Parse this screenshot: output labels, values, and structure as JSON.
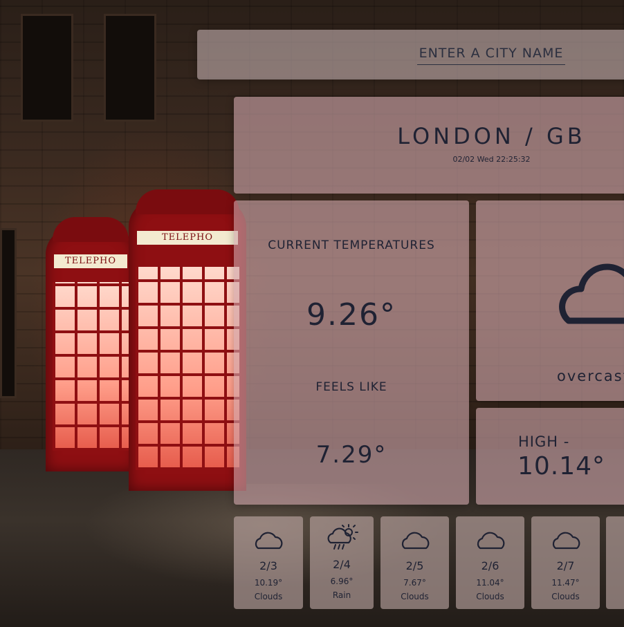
{
  "search": {
    "placeholder": "ENTER A CITY NAME"
  },
  "location": {
    "title": "LONDON / GB",
    "datetime": "02/02 Wed 22:25:32"
  },
  "current": {
    "temp_label": "CURRENT TEMPERATURES",
    "temp_value": "9.26°",
    "feels_label": "FEELS LIKE",
    "feels_value": "7.29°"
  },
  "condition": {
    "icon": "cloud-icon",
    "description": "overcast c"
  },
  "high": {
    "label": "HIGH -",
    "value": "10.14°"
  },
  "forecast": [
    {
      "date": "2/3",
      "temp": "10.19°",
      "condition": "Clouds",
      "icon": "cloud-icon"
    },
    {
      "date": "2/4",
      "temp": "6.96°",
      "condition": "Rain",
      "icon": "rain-sun-icon"
    },
    {
      "date": "2/5",
      "temp": "7.67°",
      "condition": "Clouds",
      "icon": "cloud-icon"
    },
    {
      "date": "2/6",
      "temp": "11.04°",
      "condition": "Clouds",
      "icon": "cloud-icon"
    },
    {
      "date": "2/7",
      "temp": "11.47°",
      "condition": "Clouds",
      "icon": "cloud-icon"
    }
  ],
  "background_scene": {
    "booth_signs": [
      "TELEPHO",
      "TELEPHO"
    ]
  },
  "colors": {
    "text": "#1f2233",
    "panel": "#cda5aa",
    "booth_red": "#8e0f12"
  }
}
